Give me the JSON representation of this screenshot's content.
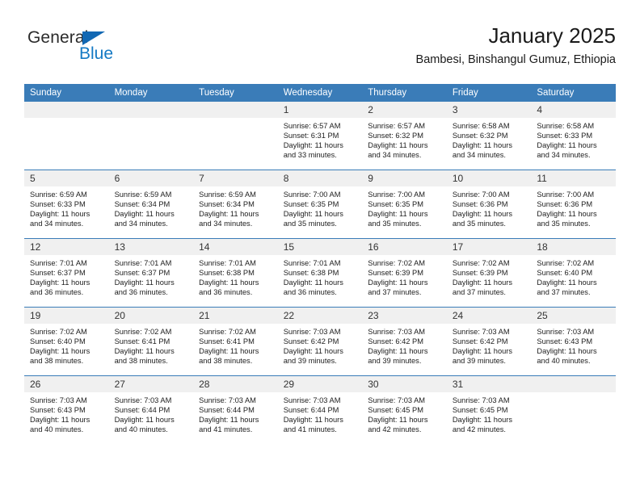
{
  "logo": {
    "word_top": "General",
    "word_bottom": "Blue",
    "accent_color": "#1268b3",
    "text_color": "#2b2b2b"
  },
  "header": {
    "title": "January 2025",
    "subtitle": "Bambesi, Binshangul Gumuz, Ethiopia"
  },
  "theme": {
    "header_band": "#3a7cb8",
    "daynum_band": "#f0f0f0",
    "text": "#1d1d1d"
  },
  "calendar": {
    "weekday_headers": [
      "Sunday",
      "Monday",
      "Tuesday",
      "Wednesday",
      "Thursday",
      "Friday",
      "Saturday"
    ],
    "weeks": [
      [
        {
          "day": "",
          "empty": true,
          "sunrise": "",
          "sunset": "",
          "daylight_line1": "",
          "daylight_line2": ""
        },
        {
          "day": "",
          "empty": true,
          "sunrise": "",
          "sunset": "",
          "daylight_line1": "",
          "daylight_line2": ""
        },
        {
          "day": "",
          "empty": true,
          "sunrise": "",
          "sunset": "",
          "daylight_line1": "",
          "daylight_line2": ""
        },
        {
          "day": "1",
          "sunrise": "Sunrise: 6:57 AM",
          "sunset": "Sunset: 6:31 PM",
          "daylight_line1": "Daylight: 11 hours",
          "daylight_line2": "and 33 minutes."
        },
        {
          "day": "2",
          "sunrise": "Sunrise: 6:57 AM",
          "sunset": "Sunset: 6:32 PM",
          "daylight_line1": "Daylight: 11 hours",
          "daylight_line2": "and 34 minutes."
        },
        {
          "day": "3",
          "sunrise": "Sunrise: 6:58 AM",
          "sunset": "Sunset: 6:32 PM",
          "daylight_line1": "Daylight: 11 hours",
          "daylight_line2": "and 34 minutes."
        },
        {
          "day": "4",
          "sunrise": "Sunrise: 6:58 AM",
          "sunset": "Sunset: 6:33 PM",
          "daylight_line1": "Daylight: 11 hours",
          "daylight_line2": "and 34 minutes."
        }
      ],
      [
        {
          "day": "5",
          "sunrise": "Sunrise: 6:59 AM",
          "sunset": "Sunset: 6:33 PM",
          "daylight_line1": "Daylight: 11 hours",
          "daylight_line2": "and 34 minutes."
        },
        {
          "day": "6",
          "sunrise": "Sunrise: 6:59 AM",
          "sunset": "Sunset: 6:34 PM",
          "daylight_line1": "Daylight: 11 hours",
          "daylight_line2": "and 34 minutes."
        },
        {
          "day": "7",
          "sunrise": "Sunrise: 6:59 AM",
          "sunset": "Sunset: 6:34 PM",
          "daylight_line1": "Daylight: 11 hours",
          "daylight_line2": "and 34 minutes."
        },
        {
          "day": "8",
          "sunrise": "Sunrise: 7:00 AM",
          "sunset": "Sunset: 6:35 PM",
          "daylight_line1": "Daylight: 11 hours",
          "daylight_line2": "and 35 minutes."
        },
        {
          "day": "9",
          "sunrise": "Sunrise: 7:00 AM",
          "sunset": "Sunset: 6:35 PM",
          "daylight_line1": "Daylight: 11 hours",
          "daylight_line2": "and 35 minutes."
        },
        {
          "day": "10",
          "sunrise": "Sunrise: 7:00 AM",
          "sunset": "Sunset: 6:36 PM",
          "daylight_line1": "Daylight: 11 hours",
          "daylight_line2": "and 35 minutes."
        },
        {
          "day": "11",
          "sunrise": "Sunrise: 7:00 AM",
          "sunset": "Sunset: 6:36 PM",
          "daylight_line1": "Daylight: 11 hours",
          "daylight_line2": "and 35 minutes."
        }
      ],
      [
        {
          "day": "12",
          "sunrise": "Sunrise: 7:01 AM",
          "sunset": "Sunset: 6:37 PM",
          "daylight_line1": "Daylight: 11 hours",
          "daylight_line2": "and 36 minutes."
        },
        {
          "day": "13",
          "sunrise": "Sunrise: 7:01 AM",
          "sunset": "Sunset: 6:37 PM",
          "daylight_line1": "Daylight: 11 hours",
          "daylight_line2": "and 36 minutes."
        },
        {
          "day": "14",
          "sunrise": "Sunrise: 7:01 AM",
          "sunset": "Sunset: 6:38 PM",
          "daylight_line1": "Daylight: 11 hours",
          "daylight_line2": "and 36 minutes."
        },
        {
          "day": "15",
          "sunrise": "Sunrise: 7:01 AM",
          "sunset": "Sunset: 6:38 PM",
          "daylight_line1": "Daylight: 11 hours",
          "daylight_line2": "and 36 minutes."
        },
        {
          "day": "16",
          "sunrise": "Sunrise: 7:02 AM",
          "sunset": "Sunset: 6:39 PM",
          "daylight_line1": "Daylight: 11 hours",
          "daylight_line2": "and 37 minutes."
        },
        {
          "day": "17",
          "sunrise": "Sunrise: 7:02 AM",
          "sunset": "Sunset: 6:39 PM",
          "daylight_line1": "Daylight: 11 hours",
          "daylight_line2": "and 37 minutes."
        },
        {
          "day": "18",
          "sunrise": "Sunrise: 7:02 AM",
          "sunset": "Sunset: 6:40 PM",
          "daylight_line1": "Daylight: 11 hours",
          "daylight_line2": "and 37 minutes."
        }
      ],
      [
        {
          "day": "19",
          "sunrise": "Sunrise: 7:02 AM",
          "sunset": "Sunset: 6:40 PM",
          "daylight_line1": "Daylight: 11 hours",
          "daylight_line2": "and 38 minutes."
        },
        {
          "day": "20",
          "sunrise": "Sunrise: 7:02 AM",
          "sunset": "Sunset: 6:41 PM",
          "daylight_line1": "Daylight: 11 hours",
          "daylight_line2": "and 38 minutes."
        },
        {
          "day": "21",
          "sunrise": "Sunrise: 7:02 AM",
          "sunset": "Sunset: 6:41 PM",
          "daylight_line1": "Daylight: 11 hours",
          "daylight_line2": "and 38 minutes."
        },
        {
          "day": "22",
          "sunrise": "Sunrise: 7:03 AM",
          "sunset": "Sunset: 6:42 PM",
          "daylight_line1": "Daylight: 11 hours",
          "daylight_line2": "and 39 minutes."
        },
        {
          "day": "23",
          "sunrise": "Sunrise: 7:03 AM",
          "sunset": "Sunset: 6:42 PM",
          "daylight_line1": "Daylight: 11 hours",
          "daylight_line2": "and 39 minutes."
        },
        {
          "day": "24",
          "sunrise": "Sunrise: 7:03 AM",
          "sunset": "Sunset: 6:42 PM",
          "daylight_line1": "Daylight: 11 hours",
          "daylight_line2": "and 39 minutes."
        },
        {
          "day": "25",
          "sunrise": "Sunrise: 7:03 AM",
          "sunset": "Sunset: 6:43 PM",
          "daylight_line1": "Daylight: 11 hours",
          "daylight_line2": "and 40 minutes."
        }
      ],
      [
        {
          "day": "26",
          "sunrise": "Sunrise: 7:03 AM",
          "sunset": "Sunset: 6:43 PM",
          "daylight_line1": "Daylight: 11 hours",
          "daylight_line2": "and 40 minutes."
        },
        {
          "day": "27",
          "sunrise": "Sunrise: 7:03 AM",
          "sunset": "Sunset: 6:44 PM",
          "daylight_line1": "Daylight: 11 hours",
          "daylight_line2": "and 40 minutes."
        },
        {
          "day": "28",
          "sunrise": "Sunrise: 7:03 AM",
          "sunset": "Sunset: 6:44 PM",
          "daylight_line1": "Daylight: 11 hours",
          "daylight_line2": "and 41 minutes."
        },
        {
          "day": "29",
          "sunrise": "Sunrise: 7:03 AM",
          "sunset": "Sunset: 6:44 PM",
          "daylight_line1": "Daylight: 11 hours",
          "daylight_line2": "and 41 minutes."
        },
        {
          "day": "30",
          "sunrise": "Sunrise: 7:03 AM",
          "sunset": "Sunset: 6:45 PM",
          "daylight_line1": "Daylight: 11 hours",
          "daylight_line2": "and 42 minutes."
        },
        {
          "day": "31",
          "sunrise": "Sunrise: 7:03 AM",
          "sunset": "Sunset: 6:45 PM",
          "daylight_line1": "Daylight: 11 hours",
          "daylight_line2": "and 42 minutes."
        },
        {
          "day": "",
          "empty": true,
          "sunrise": "",
          "sunset": "",
          "daylight_line1": "",
          "daylight_line2": ""
        }
      ]
    ]
  }
}
